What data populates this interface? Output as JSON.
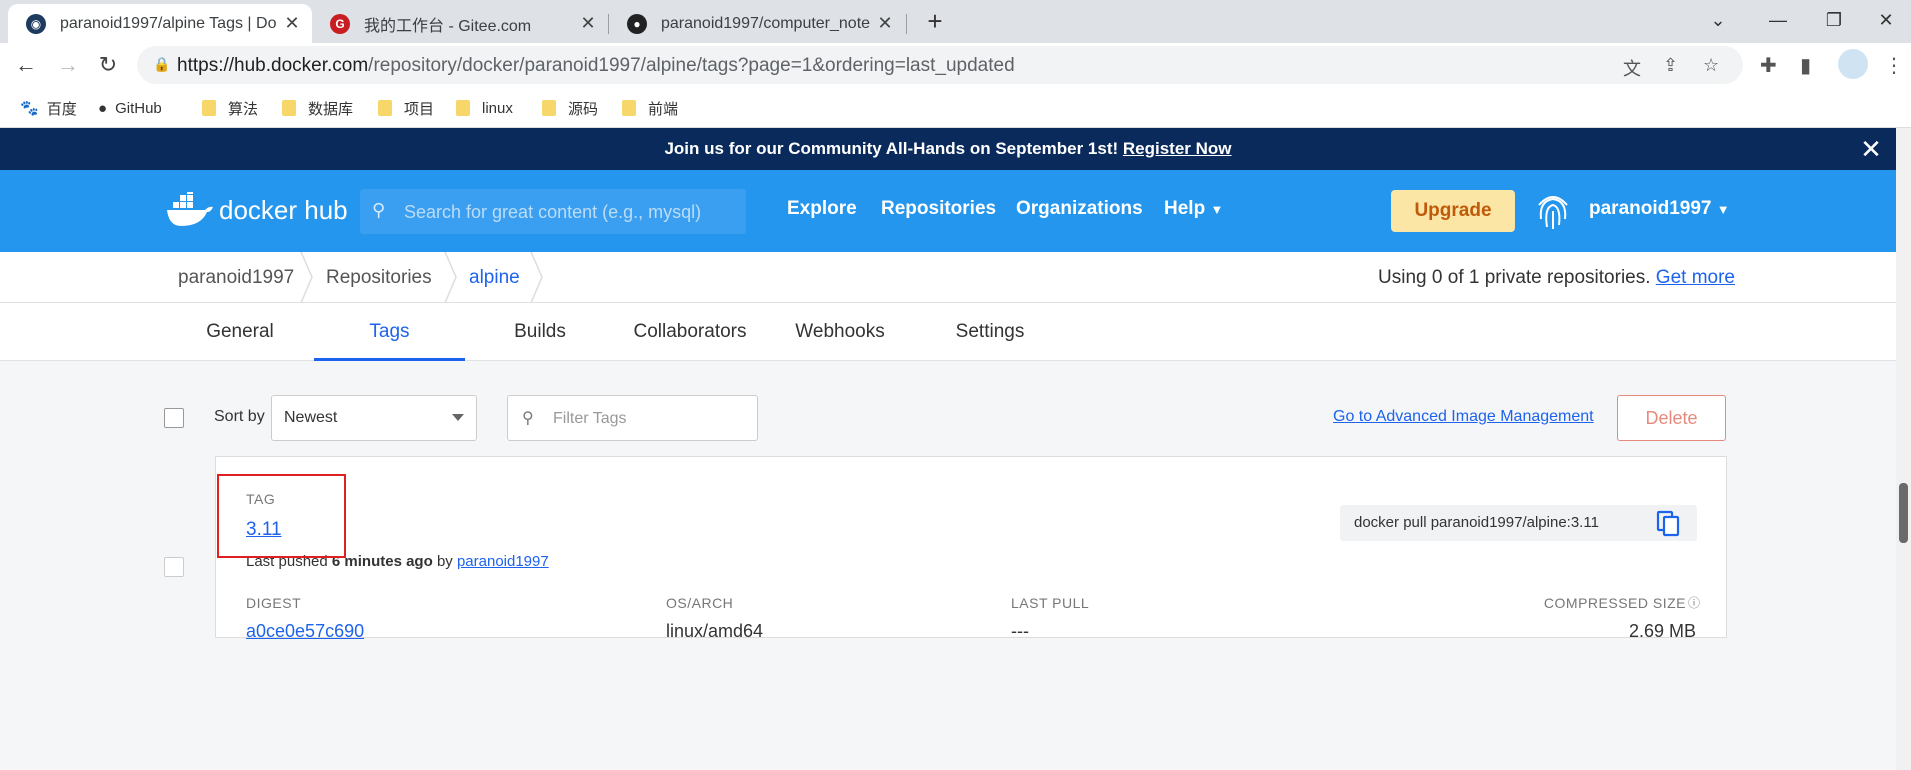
{
  "browser": {
    "tabs": [
      {
        "title": "paranoid1997/alpine Tags | Do",
        "favicon": "docker-icon",
        "active": true
      },
      {
        "title": "我的工作台 - Gitee.com",
        "favicon": "gitee-icon",
        "active": false
      },
      {
        "title": "paranoid1997/computer_note",
        "favicon": "github-icon",
        "active": false
      }
    ],
    "url_host": "https://hub.docker.com",
    "url_path": "/repository/docker/paranoid1997/alpine/tags?page=1&ordering=last_updated",
    "bookmarks": [
      {
        "label": "百度",
        "icon": "baidu-icon"
      },
      {
        "label": "GitHub",
        "icon": "github-icon"
      },
      {
        "label": "算法",
        "icon": "folder-icon"
      },
      {
        "label": "数据库",
        "icon": "folder-icon"
      },
      {
        "label": "项目",
        "icon": "folder-icon"
      },
      {
        "label": "linux",
        "icon": "folder-icon"
      },
      {
        "label": "源码",
        "icon": "folder-icon"
      },
      {
        "label": "前端",
        "icon": "folder-icon"
      }
    ]
  },
  "banner": {
    "text": "Join us for our Community All-Hands on September 1st!",
    "link": "Register Now"
  },
  "hub_nav": {
    "logo_text": "docker hub",
    "search_placeholder": "Search for great content (e.g., mysql)",
    "links": [
      "Explore",
      "Repositories",
      "Organizations",
      "Help"
    ],
    "upgrade_label": "Upgrade",
    "username": "paranoid1997"
  },
  "breadcrumbs": [
    "paranoid1997",
    "Repositories",
    "alpine"
  ],
  "private_repos": {
    "text": "Using 0 of 1 private repositories.",
    "link": "Get more"
  },
  "repo_tabs": [
    {
      "label": "General",
      "active": false
    },
    {
      "label": "Tags",
      "active": true
    },
    {
      "label": "Builds",
      "active": false
    },
    {
      "label": "Collaborators",
      "active": false
    },
    {
      "label": "Webhooks",
      "active": false
    },
    {
      "label": "Settings",
      "active": false
    }
  ],
  "toolbar": {
    "sort_label": "Sort by",
    "sort_value": "Newest",
    "filter_placeholder": "Filter Tags",
    "advanced_link": "Go to Advanced Image Management",
    "delete_label": "Delete"
  },
  "tag_card": {
    "tag_label": "TAG",
    "tag_name": "3.11",
    "pushed_prefix": "Last pushed",
    "pushed_time": "6 minutes ago",
    "pushed_by_word": "by",
    "pushed_by": "paranoid1997",
    "pull_command": "docker pull paranoid1997/alpine:3.11",
    "columns": {
      "digest_label": "DIGEST",
      "digest_value": "a0ce0e57c690",
      "osarch_label": "OS/ARCH",
      "osarch_value": "linux/amd64",
      "lastpull_label": "LAST PULL",
      "lastpull_value": "---",
      "size_label": "COMPRESSED SIZE",
      "size_value": "2.69 MB"
    }
  },
  "colors": {
    "brand_blue": "#2496ed",
    "banner_navy": "#0a2a5c",
    "link_blue": "#1d63ed",
    "upgrade_bg": "#fbe6a6",
    "delete_red": "#e58a7c",
    "annotation_red": "#e02020"
  }
}
